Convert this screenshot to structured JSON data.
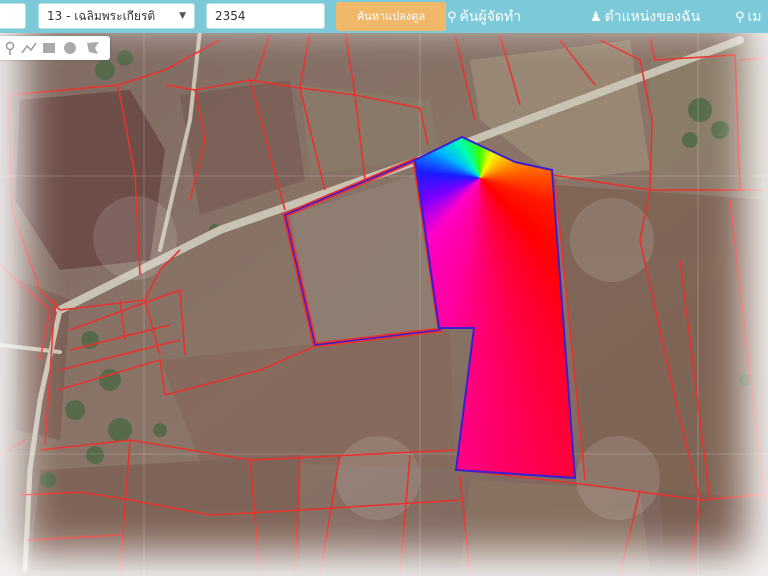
{
  "toolbar": {
    "district_select": "13 - เฉลิมพระเกียรติ",
    "parcel_number": "2354",
    "search_button": "ค้นหาแปลงดูล",
    "nav_find_agent": "ค้นผู้จัดทำ",
    "nav_my_position": "ตำแหน่งของฉัน",
    "nav_more_partial": "เม"
  },
  "draw_tools": [
    "marker-icon",
    "line-icon",
    "rectangle-icon",
    "circle-icon",
    "polygon-icon"
  ],
  "colors": {
    "topbar": "#7ccad9",
    "parcel_boundary": "#e8322e",
    "selected_outline": "#3a1fd0",
    "search_button": "#f2b86a"
  }
}
